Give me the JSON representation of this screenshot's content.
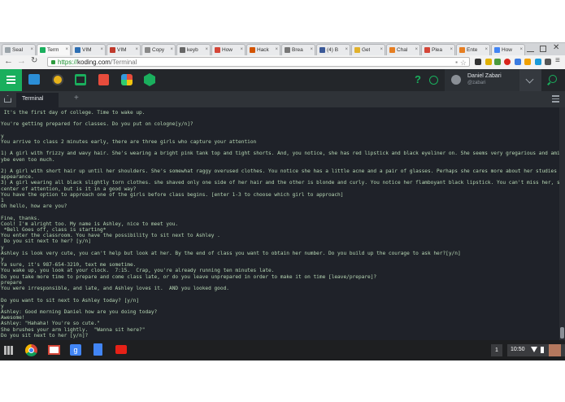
{
  "tabs": [
    {
      "label": "Seal",
      "icon": "play-icon",
      "color": "#9aa3a9"
    },
    {
      "label": "Term",
      "icon": "koding-icon",
      "color": "#1aaf5d",
      "active": true
    },
    {
      "label": "VIM",
      "icon": "vim-icon",
      "color": "#2d6fb3"
    },
    {
      "label": "VIM",
      "icon": "vim-icon",
      "color": "#c0392b"
    },
    {
      "label": "Copy",
      "icon": "doc-icon",
      "color": "#888888"
    },
    {
      "label": "keyb",
      "icon": "w-icon",
      "color": "#666666"
    },
    {
      "label": "How",
      "icon": "gmail-icon",
      "color": "#d44638"
    },
    {
      "label": "Hack",
      "icon": "hn-icon",
      "color": "#d35400"
    },
    {
      "label": "Brea",
      "icon": "page-icon",
      "color": "#777777"
    },
    {
      "label": "(4) B",
      "icon": "facebook-icon",
      "color": "#3b5998"
    },
    {
      "label": "Get",
      "icon": "mail-icon",
      "color": "#e1b12c"
    },
    {
      "label": "Chal",
      "icon": "site-icon",
      "color": "#e67e22"
    },
    {
      "label": "Plea",
      "icon": "gmail-icon",
      "color": "#d44638"
    },
    {
      "label": "Ente",
      "icon": "site-icon",
      "color": "#e67e22"
    },
    {
      "label": "How",
      "icon": "google-icon",
      "color": "#4285f4"
    }
  ],
  "address": {
    "scheme": "https://",
    "host": "koding.com",
    "path": "/Terminal"
  },
  "user": {
    "name": "Daniel Zabari",
    "handle": "@zabari"
  },
  "terminal_tab": {
    "label": "Terminal",
    "add": "+"
  },
  "terminal_lines": [
    " It's the first day of college. Time to wake up.",
    "",
    "You're getting prepared for classes. Do you put on cologne[y/n]?",
    "",
    "y",
    "You arrive to class 2 minutes early, there are three girls who capture your attention",
    "",
    "1) A girl with frizzy and wavy hair. She's wearing a bright pink tank top and tight shorts. And, you notice, she has red lipstick and black eyeliner on. She seems very gregarious and amicable, ma",
    "ybe even too much.",
    "",
    "2) A girl with short hair up until her shoulders. She's somewhat raggy overused clothes. You notice she has a little acne and a pair of glasses. Perhaps she cares more about her studies than her",
    "appearance.",
    "3) A girl wearing all black slightly torn clothes. she shaved only one side of her hair and the other is blonde and curly. You notice her flamboyant black lipstick. You can't miss her, she's th",
    "center of attention, but is it in a good way?",
    "You have the option to approach one of the girls before class begins. [enter 1-3 to choose which girl to approach]",
    "1",
    "Oh hello, how are you?",
    "",
    "Fine, thanks.",
    "Cool! I'm alright too. My name is Ashley, nice to meet you.",
    " *Bell Goes off, class is starting*",
    "You enter the classroom. You have the possibility to sit next to Ashley .",
    " Do you sit next to her? [y/n]",
    "y",
    "Ashley is look very cute, you can't help but look at her. By the end of class you want to obtain her number. Do you build up the courage to ask her?[y/n]",
    "y",
    "Ya sure, it's 987-654-3210, text me sometime.",
    "You wake up, you look at your clock.  7:15.  Crap, you're already running ten minutes late.",
    "Do you take more time to prepare and come class late, or do you leave unprepared in order to make it on time [leave/prepare]?",
    "prepare",
    "You were irresponsible, and late, and Ashley loves it.  AND you looked good.",
    "",
    "Do you want to sit next to Ashley today? [y/n]",
    "y",
    "Ashley: Good morning Daniel how are you doing today?",
    "Awesome!",
    "Ashley: \"Hahaha! You're so cute.\"",
    "She brushes your arm lightly.  \"Wanna sit here?\"",
    "Do you sit next to her [y/n]?"
  ],
  "shelf": {
    "page_badge": "1",
    "time": "10:50"
  },
  "colors": {
    "koding_green": "#1aaf5d",
    "header": "#23262a",
    "terminal_bg": "#1f2229",
    "terminal_text": "#b7d7b4"
  }
}
